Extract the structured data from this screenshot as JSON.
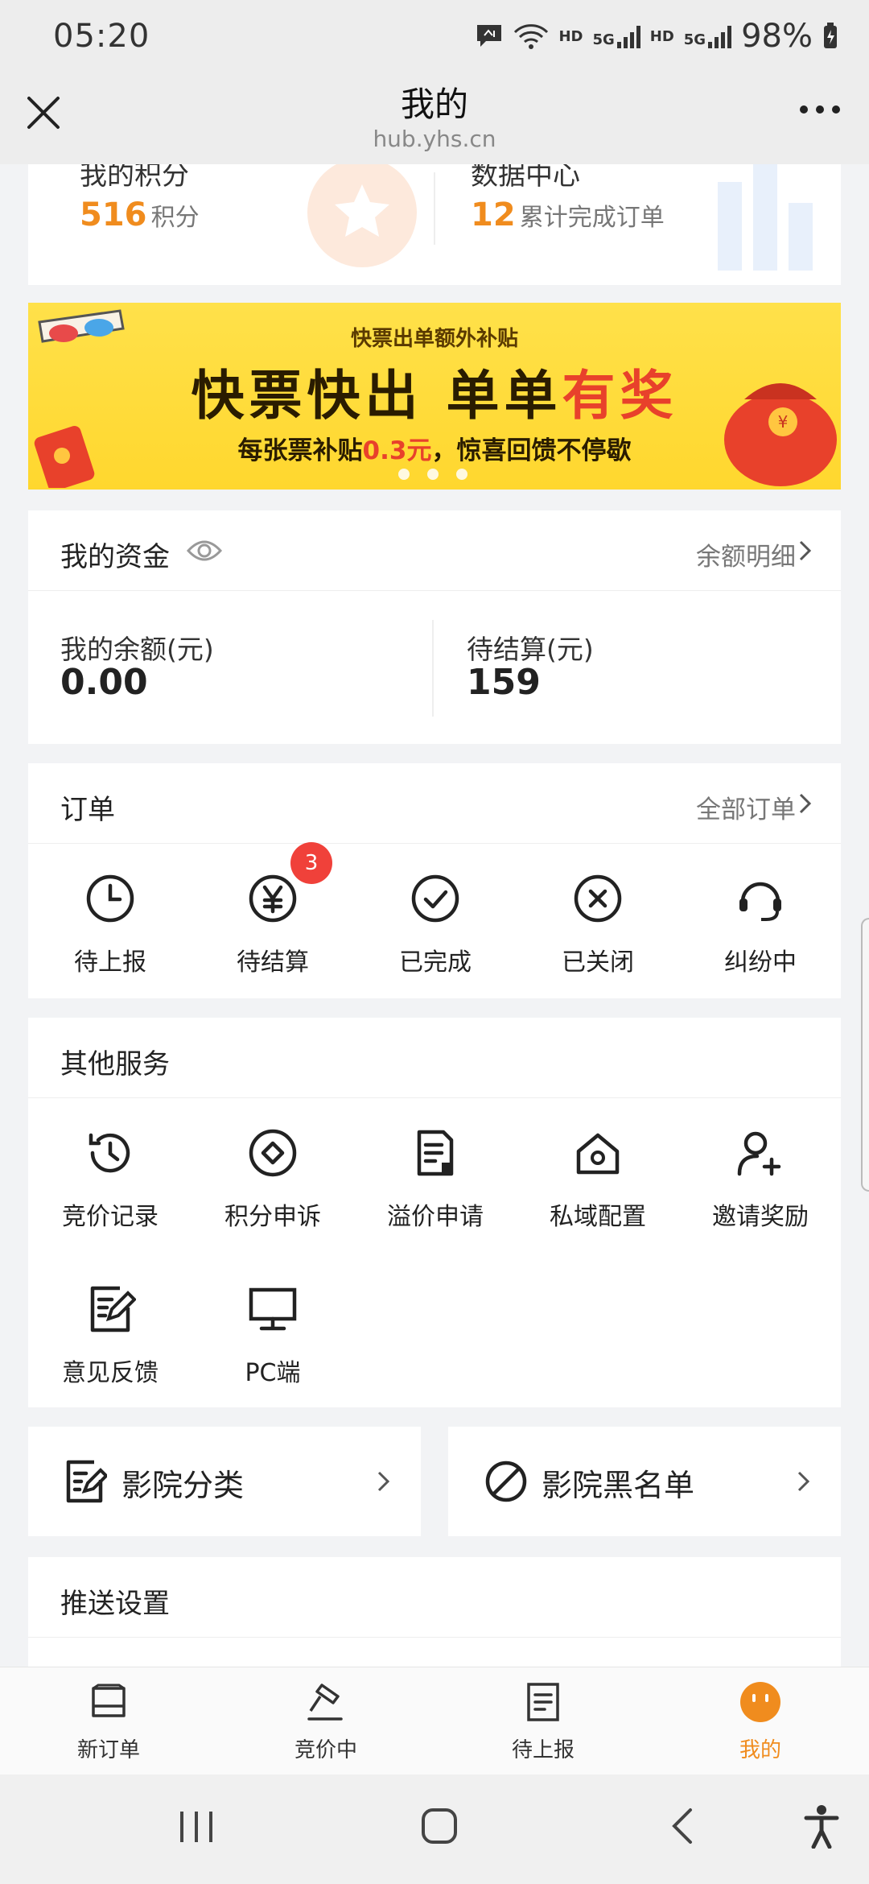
{
  "status_bar": {
    "time": "05:20",
    "battery": "98%",
    "hd1": "HD",
    "hd2": "HD",
    "net1": "5G",
    "net2": "5G"
  },
  "title_bar": {
    "title": "我的",
    "subtitle": "hub.yhs.cn"
  },
  "points": {
    "label": "我的积分",
    "value": "516",
    "unit": "积分",
    "data_label": "数据中心",
    "data_value": "12",
    "data_unit": "累计完成订单"
  },
  "banner": {
    "sub": "快票出单额外补贴",
    "main_a": "快票快出 单单",
    "main_b": "有奖",
    "foot_a": "每张票补贴",
    "foot_b": "0.3元",
    "foot_c": "，惊喜回馈不停歇"
  },
  "funds": {
    "title": "我的资金",
    "link": "余额明细",
    "balance_label": "我的余额(元)",
    "balance_value": "0.00",
    "pending_label": "待结算(元)",
    "pending_value": "159"
  },
  "orders": {
    "title": "订单",
    "link": "全部订单",
    "items": [
      {
        "label": "待上报",
        "icon": "clock-icon"
      },
      {
        "label": "待结算",
        "icon": "yen-icon",
        "badge": "3"
      },
      {
        "label": "已完成",
        "icon": "check-circle-icon"
      },
      {
        "label": "已关闭",
        "icon": "x-circle-icon"
      },
      {
        "label": "纠纷中",
        "icon": "headset-icon"
      }
    ]
  },
  "services": {
    "title": "其他服务",
    "items": [
      {
        "label": "竞价记录",
        "icon": "history-icon"
      },
      {
        "label": "积分申诉",
        "icon": "diamond-circle-icon"
      },
      {
        "label": "溢价申请",
        "icon": "document-icon"
      },
      {
        "label": "私域配置",
        "icon": "home-gear-icon"
      },
      {
        "label": "邀请奖励",
        "icon": "user-plus-icon"
      },
      {
        "label": "意见反馈",
        "icon": "edit-note-icon"
      },
      {
        "label": "PC端",
        "icon": "monitor-icon"
      }
    ]
  },
  "cinema": {
    "category": "影院分类",
    "blacklist": "影院黑名单"
  },
  "push": {
    "title": "推送设置"
  },
  "tabs": [
    {
      "label": "新订单",
      "icon": "inbox-icon"
    },
    {
      "label": "竞价中",
      "icon": "gavel-icon"
    },
    {
      "label": "待上报",
      "icon": "list-doc-icon"
    },
    {
      "label": "我的",
      "icon": "profile-face-icon",
      "active": true
    }
  ],
  "colors": {
    "accent": "#f08c1e",
    "badge": "#f0413a",
    "banner": "#ffd72e"
  }
}
